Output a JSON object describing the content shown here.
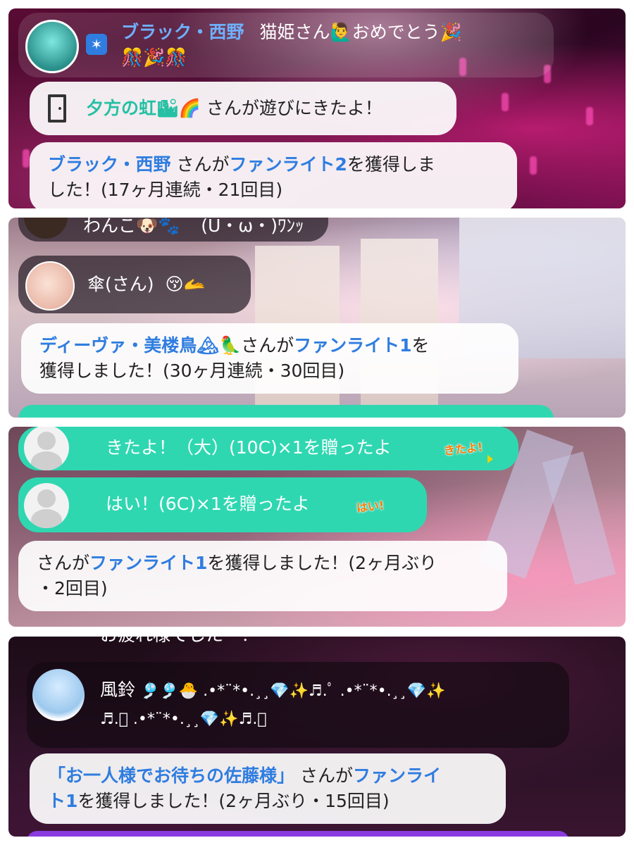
{
  "panel1": {
    "congrats": {
      "user": "ブラック・西野",
      "text": "猫姫さん🙋‍♂️おめでとう🎉",
      "text2": "🎊🎉🎊"
    },
    "visit": {
      "user": "夕方の虹🏙🌈",
      "text": " さんが遊びにきたよ！"
    },
    "fanlight": {
      "user": "ブラック・西野",
      "pre": " さんが",
      "item": "ファンライト2",
      "post": "を獲得しま",
      "line2": "した！(17ヶ月連続・21回目)"
    }
  },
  "panel2": {
    "partial": {
      "user": "わんこ🐶🐾",
      "text": "(U・ω・)ﾜﾝｯ"
    },
    "kasa": {
      "user": "傘(さん)",
      "emoji": "😚🫴"
    },
    "fanlight": {
      "user": "ディーヴァ・美楼鳥🏔🦜",
      "pre": "さんが",
      "item": "ファンライト1",
      "post": "を",
      "line2": "獲得しました！(30ヶ月連続・30回目)"
    }
  },
  "panel3": {
    "gift1": {
      "text": "きたよ！（大）(10C)×1を贈ったよ",
      "sticker": "きたよ!"
    },
    "gift2": {
      "text": "はい！(6C)×1を贈ったよ",
      "sticker": "はい!"
    },
    "fanlight": {
      "pre": "さんが",
      "item": "ファンライト1",
      "post": "を獲得しました！(2ヶ月ぶり",
      "line2": "・2回目)"
    }
  },
  "panel4": {
    "partial_top": "お疲れ様でした〜！",
    "furin": {
      "user": "風鈴",
      "line1": "🎐🎐🐣 .•*¨*•.¸¸💎✨♬.ﾟ .•*¨*•.¸¸💎✨",
      "line2": "♬.ﾟ .•*¨*•.¸¸💎✨♬.ﾟ"
    },
    "fanlight": {
      "user": "「お一人様でお待ちの佐藤様」",
      "pre": " さんが",
      "item": "ファンライ",
      "item2": "ト1",
      "post": "を獲得しました！(2ヶ月ぶり・15回目)"
    }
  },
  "colors": {
    "name_blue": "#2f7de0",
    "name_teal": "#25c0a4",
    "gift_teal": "#2fd7b1"
  }
}
